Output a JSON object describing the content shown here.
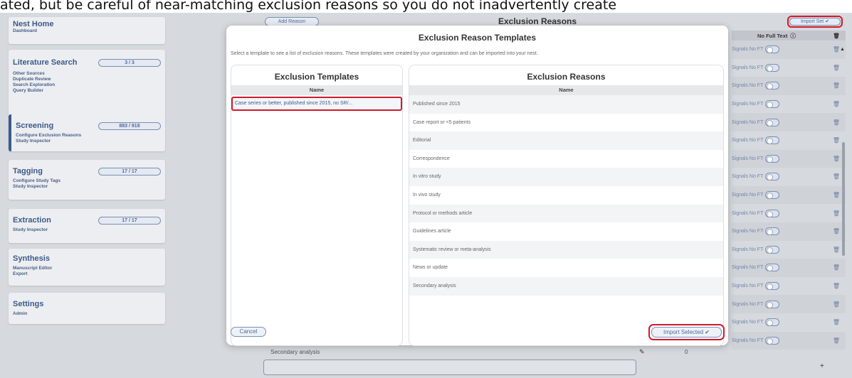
{
  "caption": "ated, but be careful of near-matching exclusion reasons so you do not inadvertently create",
  "sidebar": {
    "sections": [
      {
        "title": "Nest Home",
        "badge": "",
        "items": [
          "Dashboard"
        ]
      },
      {
        "title": "Literature Search",
        "badge": "3 / 3",
        "items": [
          "Other Sources",
          "Duplicate Review",
          "Search Exploration",
          "Query Builder"
        ]
      },
      {
        "title": "Screening",
        "badge": "883 / 918",
        "items": [
          "Configure Exclusion Reasons",
          "Study Inspector"
        ]
      },
      {
        "title": "Tagging",
        "badge": "17 / 17",
        "items": [
          "Configure Study Tags",
          "Study Inspector"
        ]
      },
      {
        "title": "Extraction",
        "badge": "17 / 17",
        "items": [
          "Study Inspector"
        ]
      },
      {
        "title": "Synthesis",
        "badge": "",
        "items": [
          "Manuscript Editor",
          "Export"
        ]
      },
      {
        "title": "Settings",
        "badge": "",
        "items": [
          "Admin"
        ]
      }
    ]
  },
  "background": {
    "add_reason_label": "Add Reason",
    "page_title": "Exclusion Reasons",
    "import_set_label": "Import Set",
    "column_no_full_text": "No Full Text",
    "signals_label": "Signals No FT",
    "bottom_row_label": "Secondary analysis",
    "bottom_row_count": "0"
  },
  "modal": {
    "title": "Exclusion Reason Templates",
    "description": "Select a template to see a list of exclusion reasons. These templates were created by your organization and can be imported into your nest.",
    "templates_title": "Exclusion Templates",
    "templates_column": "Name",
    "templates": [
      "Case series or better, published since 2015, no SR/..."
    ],
    "reasons_title": "Exclusion Reasons",
    "reasons_column": "Name",
    "reasons": [
      "Published since 2015",
      "Case report or <5 patients",
      "Editorial",
      "Correspondence",
      "In vitro study",
      "In vivo study",
      "Protocol or methods article",
      "Guidelines article",
      "Systematic review or meta-analysis",
      "News or update",
      "Secondary analysis"
    ],
    "cancel_label": "Cancel",
    "import_label": "Import Selected"
  },
  "colors": {
    "highlight": "#d11a2a",
    "accent": "#3d5a8a"
  }
}
